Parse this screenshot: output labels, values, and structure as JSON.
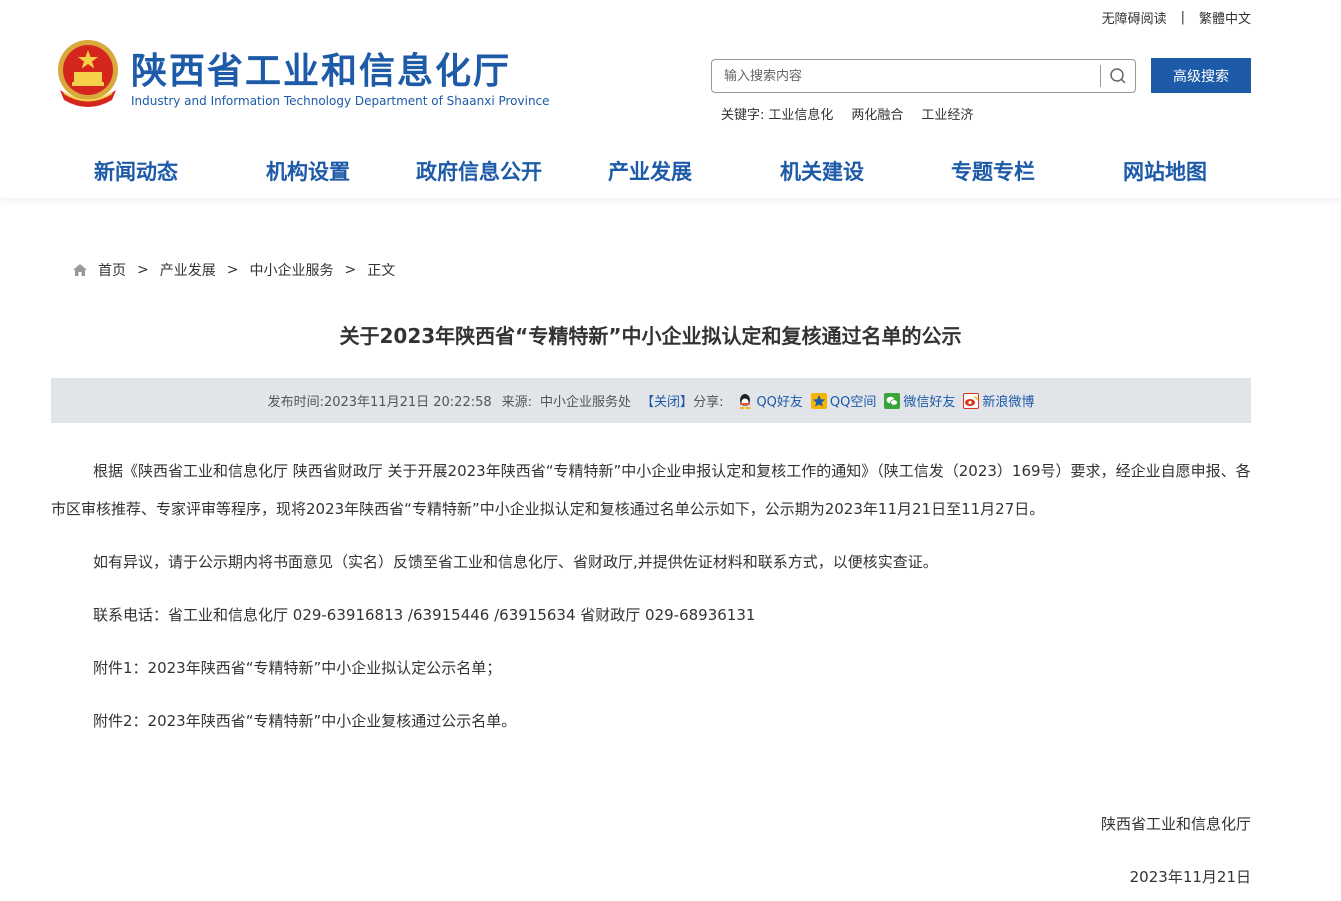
{
  "top_links": {
    "accessible": "无障碍阅读",
    "traditional": "繁體中文"
  },
  "site": {
    "title": "陕西省工业和信息化厅",
    "subtitle": "Industry and Information Technology Department of Shaanxi Province"
  },
  "search": {
    "placeholder": "输入搜索内容",
    "advanced_label": "高级搜索"
  },
  "keywords": {
    "label": "关键字:",
    "items": [
      "工业信息化",
      "两化融合",
      "工业经济"
    ]
  },
  "nav": [
    "新闻动态",
    "机构设置",
    "政府信息公开",
    "产业发展",
    "机关建设",
    "专题专栏",
    "网站地图"
  ],
  "breadcrumb": [
    "首页",
    "产业发展",
    "中小企业服务",
    "正文"
  ],
  "article": {
    "title": "关于2023年陕西省“专精特新”中小企业拟认定和复核通过名单的公示",
    "meta": {
      "publish_label": "发布时间:",
      "publish_time": "2023年11月21日 20:22:58",
      "source_label": "来源:",
      "source": "中小企业服务处",
      "close": "【关闭】",
      "share_label": "分享:",
      "share": [
        "QQ好友",
        "QQ空间",
        "微信好友",
        "新浪微博"
      ]
    },
    "paragraphs": [
      "根据《陕西省工业和信息化厅 陕西省财政厅 关于开展2023年陕西省“专精特新”中小企业申报认定和复核工作的通知》（陕工信发（2023）169号）要求，经企业自愿申报、各市区审核推荐、专家评审等程序，现将2023年陕西省“专精特新”中小企业拟认定和复核通过名单公示如下，公示期为2023年11月21日至11月27日。",
      "如有异议，请于公示期内将书面意见（实名）反馈至省工业和信息化厅、省财政厅,并提供佐证材料和联系方式，以便核实查证。",
      "联系电话：省工业和信息化厅  029-63916813 /63915446 /63915634   省财政厅  029-68936131",
      "附件1：2023年陕西省“专精特新”中小企业拟认定公示名单；",
      "附件2：2023年陕西省“专精特新”中小企业复核通过公示名单。"
    ],
    "signature": "陕西省工业和信息化厅",
    "date": "2023年11月21日"
  },
  "colors": {
    "brand": "#1d5aa8",
    "meta_bg": "#e1e4e9"
  }
}
